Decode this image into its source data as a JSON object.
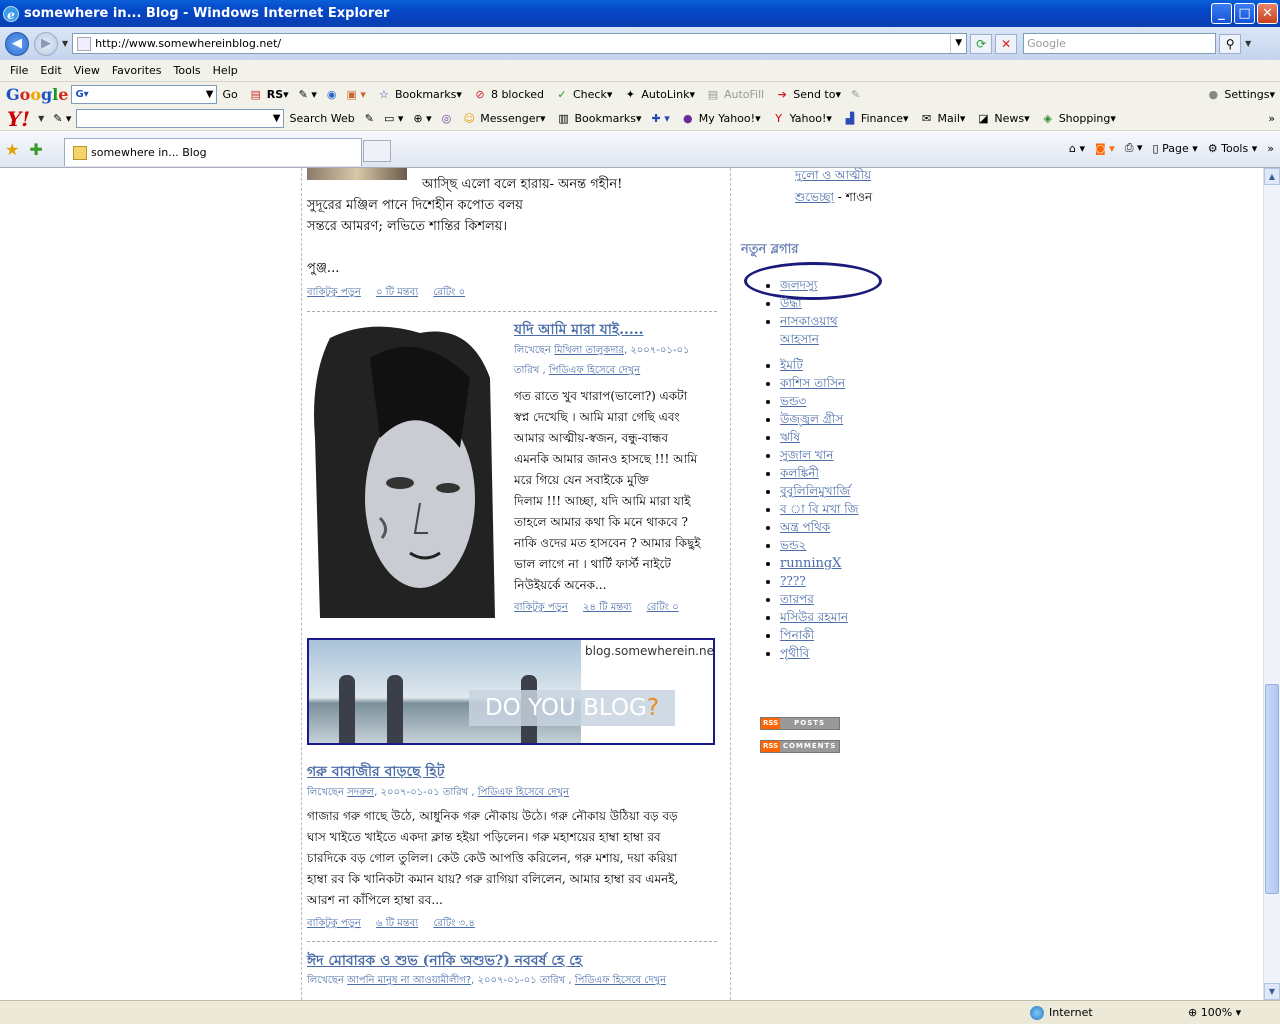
{
  "window": {
    "title": "somewhere in... Blog - Windows Internet Explorer",
    "buttons": [
      "_",
      "□",
      "✕"
    ]
  },
  "address": {
    "url": "http://www.somewhereinblog.net/",
    "search_placeholder": "Google"
  },
  "menu": [
    "File",
    "Edit",
    "View",
    "Favorites",
    "Tools",
    "Help"
  ],
  "google_toolbar": {
    "go": "Go",
    "rs": "RS",
    "bookmarks": "Bookmarks",
    "blocked": "8 blocked",
    "check": "Check",
    "autolink": "AutoLink",
    "autofill": "AutoFill",
    "sendto": "Send to",
    "settings": "Settings"
  },
  "yahoo_toolbar": {
    "search_web": "Search Web",
    "messenger": "Messenger",
    "bookmarks": "Bookmarks",
    "my_yahoo": "My Yahoo!",
    "yahoo": "Yahoo!",
    "finance": "Finance",
    "mail": "Mail",
    "news": "News",
    "shopping": "Shopping"
  },
  "tab": {
    "title": "somewhere in... Blog"
  },
  "command_bar": {
    "page": "Page",
    "tools": "Tools"
  },
  "status": {
    "zone": "Internet",
    "zoom": "100%"
  },
  "post0": {
    "lines": [
      "আস্ছি এলো বলে হারায়- অনন্ত গহীন!",
      "সুদূরের মঞ্জিল পানে দিশেহীন কপোত বলয়",
      "সন্তরে আমরণ; লভিতে শান্তির কিশলয়।",
      "পুঞ্জ..."
    ],
    "more": "বাকিটুকু পড়ুন",
    "comments": "০ টি মন্তব্য",
    "rating": "রেটিং ০"
  },
  "post1": {
    "title": "যদি আমি মারা যাই.....",
    "meta1_prefix": "লিখেছেন",
    "author": "মিথিলা তালুকদার",
    "date": ", ২০০৭-০১-০১",
    "meta2_prefix": "তারিখ , ",
    "pdf": "পিডিএফ হিসেবে দেখুন",
    "body": [
      "গত রাতে খুব খারাপ(ভালো?) একটা",
      "স্বপ্ন দেখেছি । আমি মারা গেছি এবং",
      "আমার আত্মীয়-স্বজন, বন্ধু-বান্ধব",
      "এমনকি আমার জানও হাসছে !!! আমি",
      "মরে গিয়ে যেন সবাইকে মুক্তি",
      "দিলাম !!! আচ্ছা, যদি আমি মারা যাই",
      "তাহলে আমার কথা কি মনে থাকবে ?",
      "নাকি ওদের মত হাসবেন ? আমার কিছুই",
      "ভাল লাগে না । থার্টি ফার্স্ট নাইটে",
      "নিউইয়র্কে অনেক..."
    ],
    "more": "বাকিটুকু পড়ুন",
    "comments": "২৪ টি মন্তব্য",
    "rating": "রেটিং ০"
  },
  "ad": {
    "site": "blog.somewherein.net",
    "slogan_a": "DO YOU BLOG",
    "slogan_b": "?"
  },
  "post2": {
    "title": "গরু বাবাজীর বাড়ছে হিট",
    "meta_prefix": "লিখেছেন",
    "author": "সদরুল",
    "date": ", ২০০৭-০১-০১ তারিখ , ",
    "pdf": "পিডিএফ হিসেবে দেখুন",
    "body": [
      "গাজার গরু গাছে উঠে, আধুনিক গরু নৌকায় উঠে। গরু নৌকায় উঠিয়া বড় বড়",
      "ঘাস খাইতে খাইতে একদা ক্লান্ত হইয়া পড়িলেন। গরু মহাশয়ের হাম্বা হাম্বা রব",
      "চারদিকে বড় গোল তুলিল। কেউ কেউ আপত্তি করিলেন, গরু মশায়, দয়া করিয়া",
      "হাম্বা রব কি খানিকটা কমান যায়? গরু রাগিয়া বলিলেন, আমার হাম্বা রব এমনই,",
      "আরশ না কাঁপিলে হাম্বা রব..."
    ],
    "more": "বাকিটুকু পড়ুন",
    "comments": "৬ টি মন্তব্য",
    "rating": "রেটিং ৩.৪"
  },
  "post3": {
    "title": "ঈদ মোবারক ও শুভ (নাকি অশুভ?) নববর্ষ হে হে",
    "meta_prefix": "লিখেছেন",
    "author": "আপনি মানুষ না আওয়ামীলীগ?",
    "date": ", ২০০৭-০১-০১ তারিখ , ",
    "pdf": "পিডিএফ হিসেবে দেখুন"
  },
  "sidebar": {
    "top_link1": "দুলো ও আত্মীয়",
    "top_link2": "শুভেচ্ছা",
    "top_author": " - শাওন",
    "new_bloggers_title": "নতুন ব্লগার",
    "bloggers": [
      "জলদস্যু",
      "উদ্ধা",
      "নাসকাওয়াথ",
      "আহসান",
      "ইমটি",
      "কাশিস তাসিন",
      "ভন্ড৩",
      "উজ্জ্বল গ্রীস",
      "ঋষি",
      "সুজাল খান",
      "কলঙ্কিনী",
      "বুবুলিলিমুখার্জি",
      "ব া বি মখা জি",
      "অন্ত্র পথিক",
      "ভন্ড২",
      "runningX",
      "????",
      "তারপর",
      "মসিউর রহমান",
      "পিনাকী",
      "পৃথীবি"
    ],
    "rss_posts": [
      "RSS",
      "POSTS"
    ],
    "rss_comments": [
      "RSS",
      "COMMENTS"
    ]
  }
}
